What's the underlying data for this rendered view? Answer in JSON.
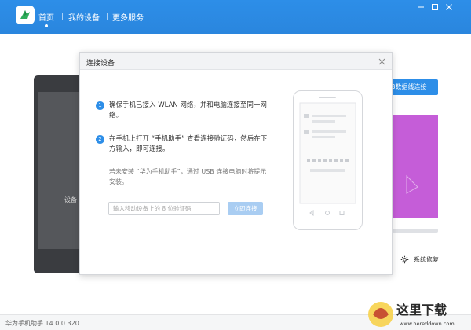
{
  "app": {
    "nav": [
      {
        "label": "首页",
        "active": true
      },
      {
        "label": "我的设备",
        "active": false
      },
      {
        "label": "更多服务",
        "active": false
      }
    ],
    "window_controls": [
      "minimize-icon",
      "maximize-icon",
      "close-icon"
    ],
    "accent": "#2d8ee8"
  },
  "background": {
    "phone_label": "设备",
    "usb_button": "B数据线连接",
    "system_repair": "系统修复"
  },
  "dialog": {
    "title": "连接设备",
    "steps": [
      {
        "num": "1",
        "text": "确保手机已接入 WLAN 网络，并和电脑连接至同一网络。"
      },
      {
        "num": "2",
        "text": "在手机上打开 “手机助手” 查看连接验证码，然后在下方输入，即可连接。"
      }
    ],
    "hint": "若未安装 “华为手机助手”，通过 USB 连接电脑时将提示安装。",
    "input_placeholder": "输入移动设备上的 8 位验证码",
    "connect_button": "立即连接"
  },
  "status": {
    "version": "华为手机助手 14.0.0.320"
  },
  "watermark": {
    "text": "这里下载",
    "url": "www.hereddown.com"
  }
}
